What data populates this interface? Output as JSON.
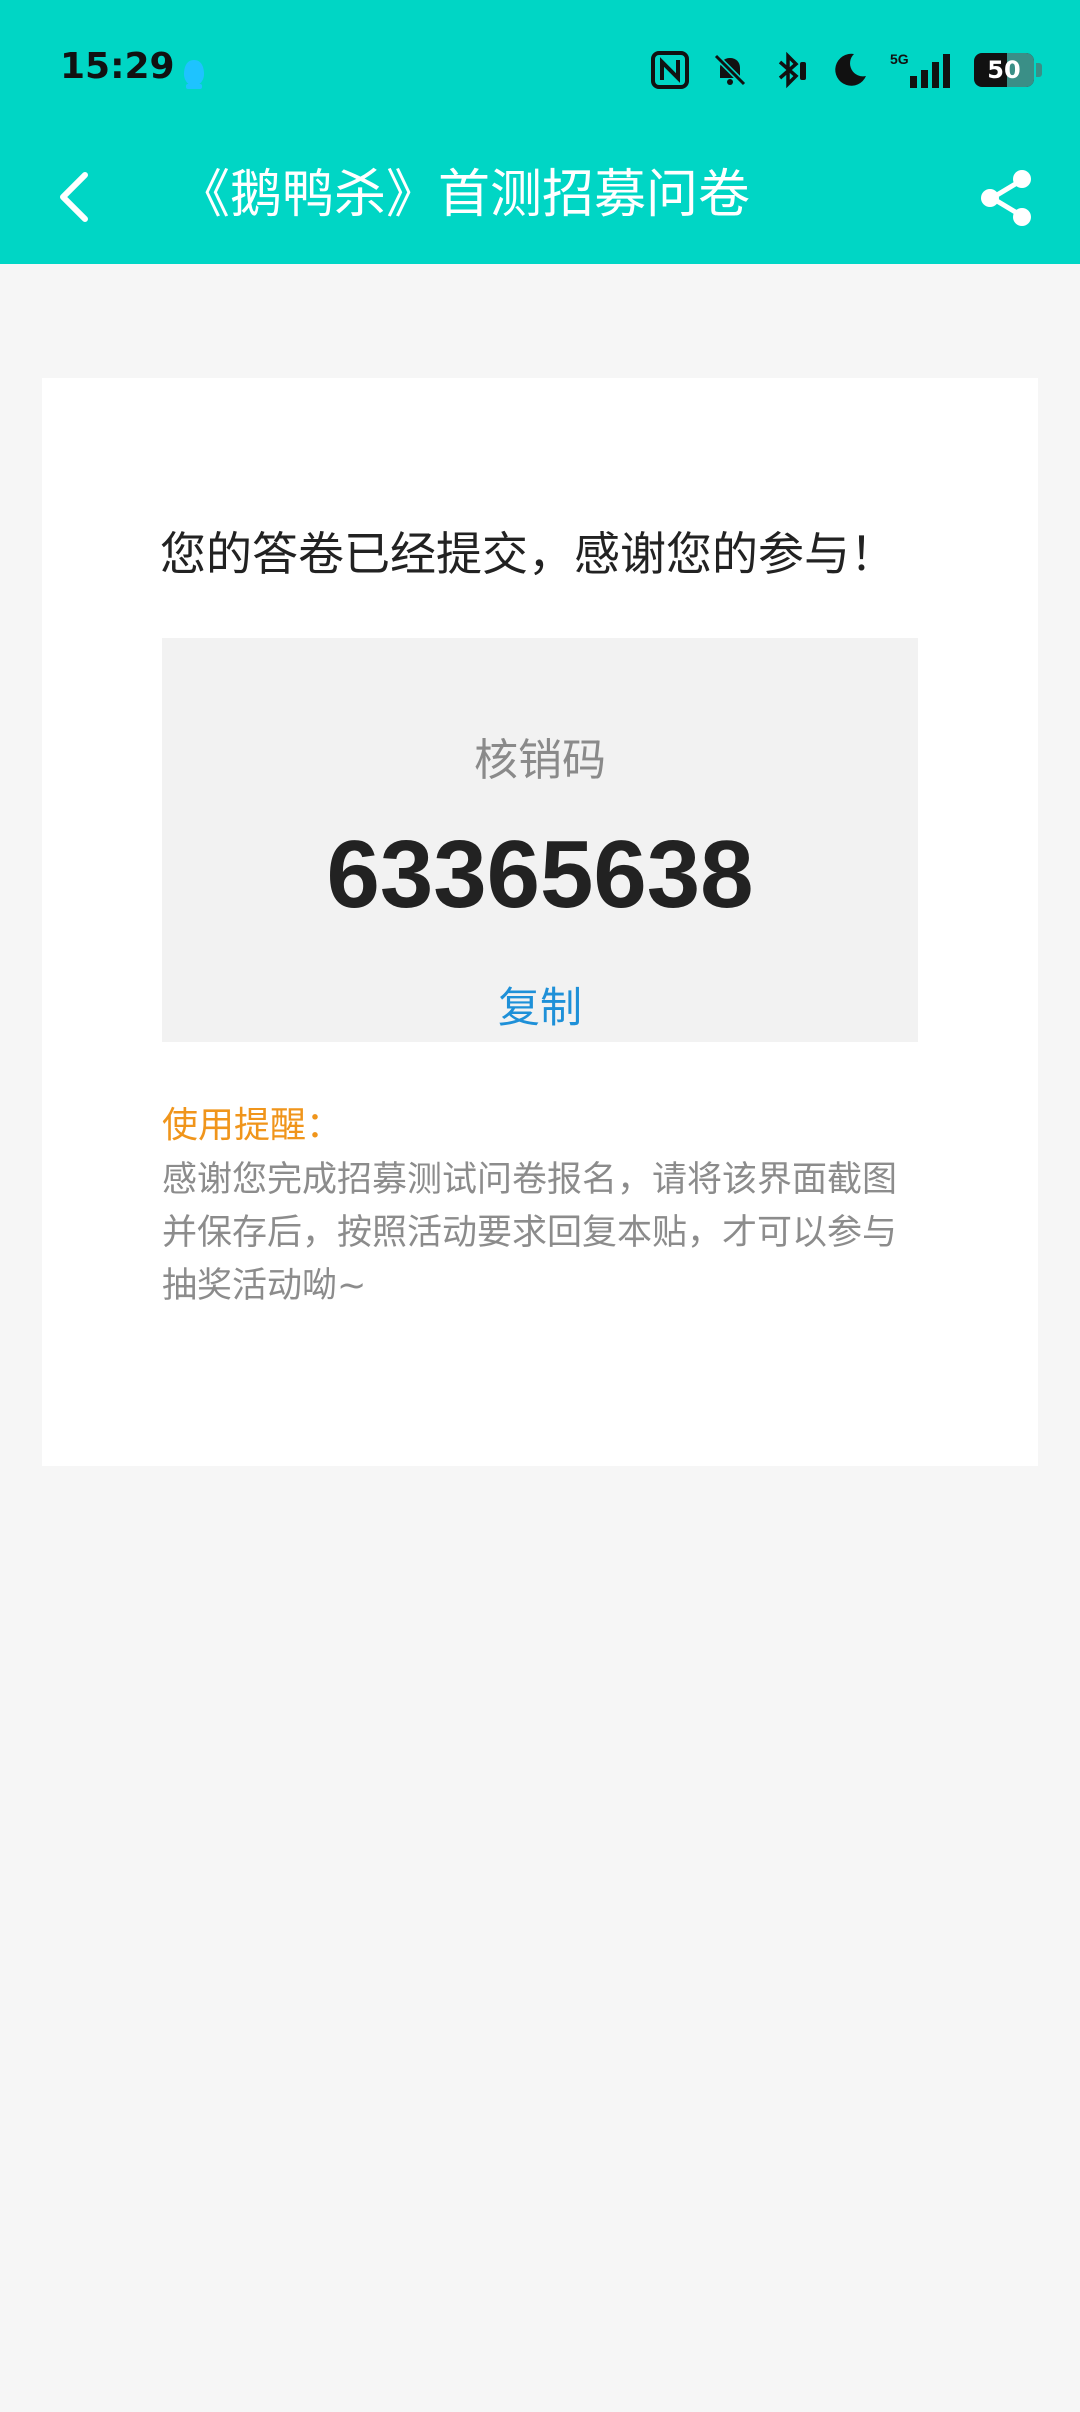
{
  "status_bar": {
    "time": "15:29",
    "battery_level": "50"
  },
  "app_bar": {
    "title": "《鹅鸭杀》首测招募问卷"
  },
  "card": {
    "success_message": "您的答卷已经提交，感谢您的参与！",
    "code_label": "核销码",
    "code_value": "63365638",
    "copy_label": "复制",
    "tip_title": "使用提醒：",
    "tip_body": "感谢您完成招募测试问卷报名，请将该界面截图并保存后，按照活动要求回复本贴，才可以参与抽奖活动呦~"
  },
  "colors": {
    "header_bg": "#00d6c5",
    "page_bg": "#f6f6f6",
    "tip_title": "#f0951b",
    "copy_link": "#1e90d8"
  }
}
